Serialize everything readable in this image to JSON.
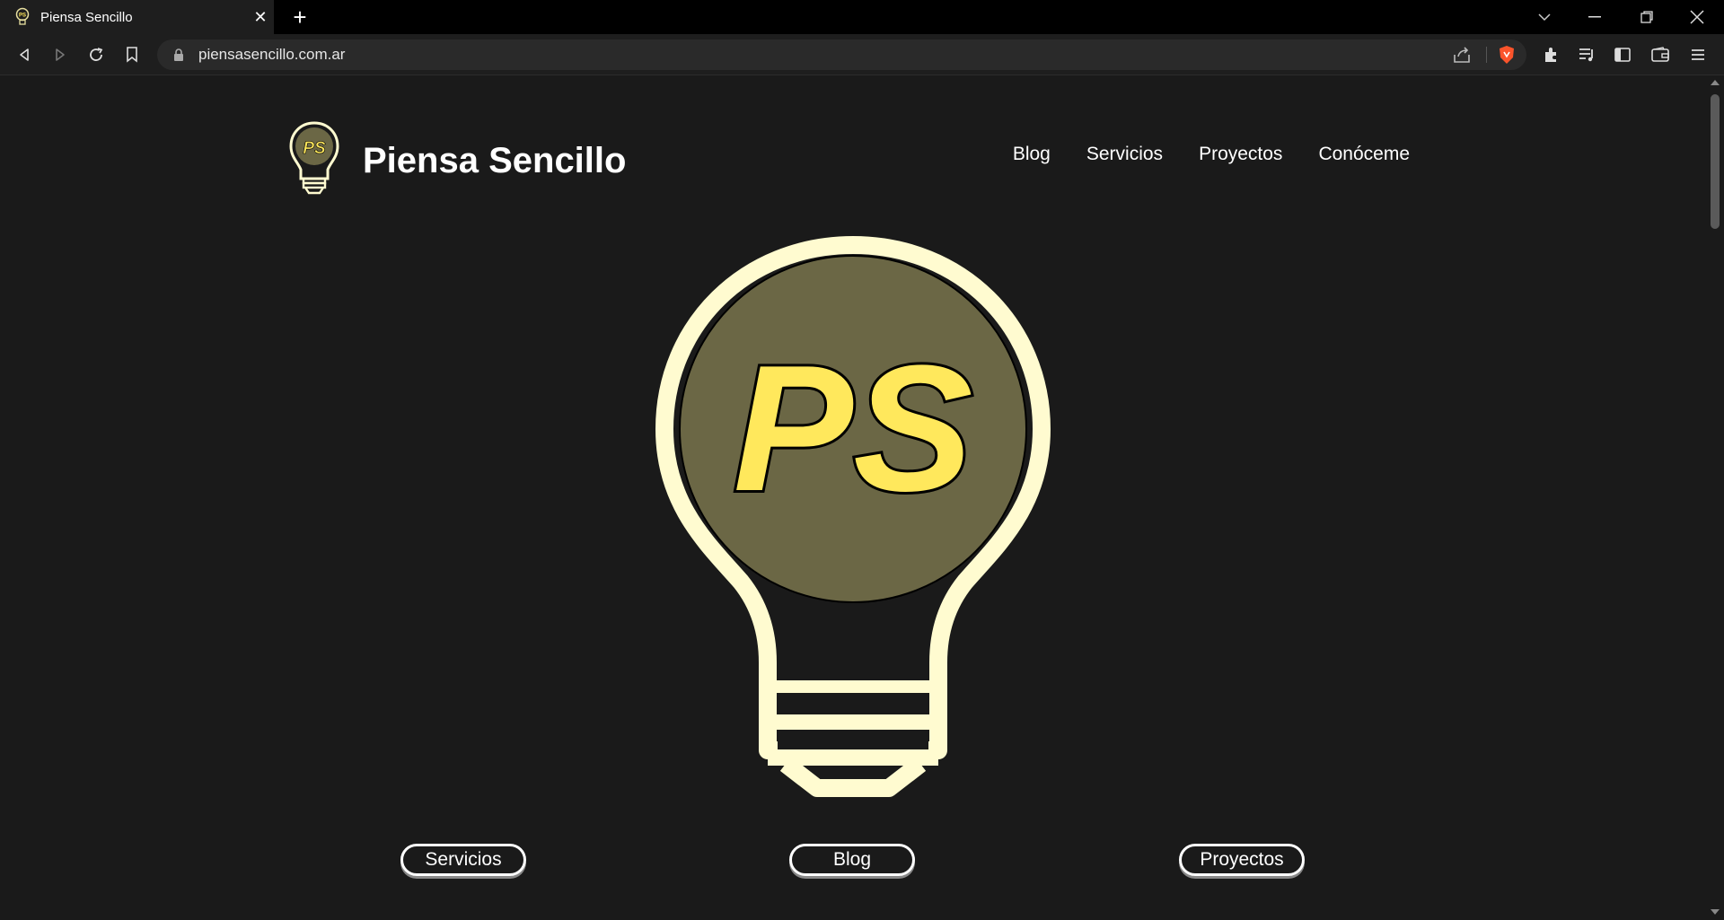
{
  "browser": {
    "tab_title": "Piensa Sencillo",
    "url": "piensasencillo.com.ar",
    "icons": [
      "back-icon",
      "forward-icon",
      "reload-icon",
      "bookmark-icon",
      "lock-icon",
      "share-icon",
      "brave-shield-icon",
      "extensions-icon",
      "playlist-icon",
      "sidebar-icon",
      "wallet-icon",
      "menu-icon"
    ]
  },
  "site": {
    "name": "Piensa Sencillo",
    "logo_text": "PS",
    "nav": [
      "Blog",
      "Servicios",
      "Proyectos",
      "Conóceme"
    ],
    "buttons": [
      "Servicios",
      "Blog",
      "Proyectos"
    ]
  },
  "colors": {
    "background": "#1a1a1a",
    "bulb_outline": "#fffbd0",
    "bulb_glass": "#6b6745",
    "logo_letters": "#ffe85c"
  }
}
